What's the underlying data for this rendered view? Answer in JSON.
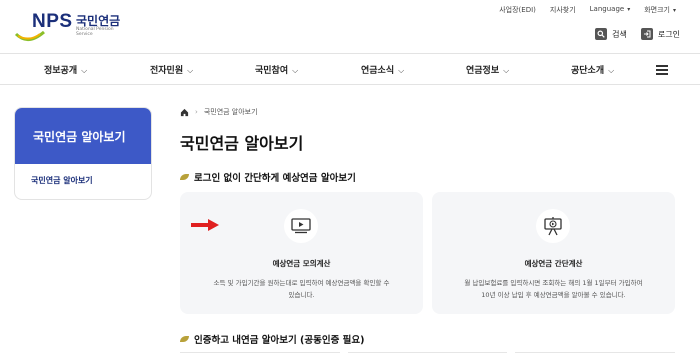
{
  "header": {
    "logo_text": "NPS",
    "logo_korean": "국민연금",
    "logo_english": "National Pension Service"
  },
  "utility_nav": [
    {
      "label": "사업장(EDI)"
    },
    {
      "label": "지사찾기"
    },
    {
      "label": "Language",
      "dropdown": true
    },
    {
      "label": "화면크기",
      "dropdown": true
    }
  ],
  "actions": {
    "search_label": "검색",
    "login_label": "로그인"
  },
  "main_nav": [
    {
      "label": "정보공개"
    },
    {
      "label": "전자민원"
    },
    {
      "label": "국민참여"
    },
    {
      "label": "연금소식"
    },
    {
      "label": "연금정보"
    },
    {
      "label": "공단소개"
    }
  ],
  "sidebar": {
    "title": "국민연금 알아보기",
    "items": [
      {
        "label": "국민연금 알아보기"
      }
    ]
  },
  "breadcrumb": {
    "current": "국민연금 알아보기"
  },
  "page_title": "국민연금 알아보기",
  "section1": {
    "title": "로그인 없이 간단하게 예상연금 알아보기"
  },
  "cards": [
    {
      "title": "예상연금 모의계산",
      "desc1": "소득 및 가입기간을 원하는대로 입력하여 예상연금액을 확인할 수",
      "desc2": "있습니다.",
      "icon": "monitor-play-icon"
    },
    {
      "title": "예상연금 간단계산",
      "desc1": "월 납입보험료를 입력하시면 조회하는 해의 1월 1일부터 가입하여",
      "desc2": "10년 이상 납입 후 예상연금액을 알아볼 수 있습니다.",
      "icon": "presentation-play-icon"
    }
  ],
  "section2": {
    "title": "인증하고 내연금 알아보기 (공동인증 필요)"
  },
  "colors": {
    "brand_navy": "#1b2f7a",
    "sidebar_blue": "#3d59c7",
    "card_bg": "#f5f6f8",
    "leaf_accent": "#b8a13a",
    "arrow_red": "#e02020"
  }
}
